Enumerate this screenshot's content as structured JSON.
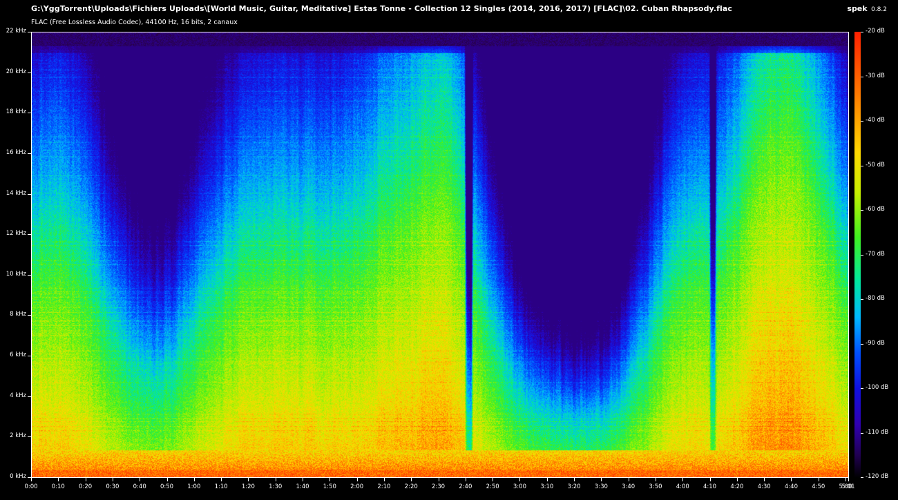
{
  "window": {
    "title": "G:\\YggTorrent\\Uploads\\Fichiers Uploads\\[World Music, Guitar, Meditative] Estas Tonne - Collection 12 Singles (2014, 2016, 2017) [FLAC]\\02. Cuban Rhapsody.flac",
    "subtitle": "FLAC (Free Lossless Audio Codec), 44100 Hz, 16 bits, 2 canaux",
    "app_name": "spek",
    "app_version": "0.8.2"
  },
  "freq_axis": {
    "labels": [
      "22 kHz",
      "20 kHz",
      "18 kHz",
      "16 kHz",
      "14 kHz",
      "12 kHz",
      "10 kHz",
      "8 kHz",
      "6 kHz",
      "4 kHz",
      "2 kHz",
      "0 kHz"
    ]
  },
  "time_axis": {
    "labels": [
      "0:00",
      "0:10",
      "0:20",
      "0:30",
      "0:40",
      "0:50",
      "1:00",
      "1:10",
      "1:20",
      "1:30",
      "1:40",
      "1:50",
      "2:00",
      "2:10",
      "2:20",
      "2:30",
      "2:40",
      "2:50",
      "3:00",
      "3:10",
      "3:20",
      "3:30",
      "3:40",
      "3:50",
      "4:00",
      "4:10",
      "4:20",
      "4:30",
      "4:40",
      "4:50",
      "5:00",
      "5:01"
    ]
  },
  "db_axis": {
    "labels": [
      "-20 dB",
      "-30 dB",
      "-40 dB",
      "-50 dB",
      "-60 dB",
      "-70 dB",
      "-80 dB",
      "-90 dB",
      "-100 dB",
      "-110 dB",
      "-120 dB"
    ]
  },
  "colors": {
    "background": "#000000",
    "text": "#ffffff",
    "plot_border": "#ffffff"
  }
}
